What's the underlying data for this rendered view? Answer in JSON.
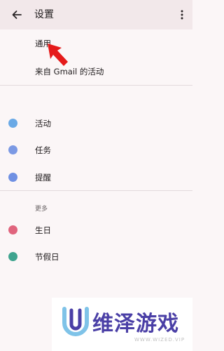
{
  "appbar": {
    "title": "设置"
  },
  "general_items": [
    {
      "label": "通用"
    },
    {
      "label": "来自 Gmail 的活动"
    }
  ],
  "calendar_items": [
    {
      "label": "活动",
      "color": "#6aa9e6"
    },
    {
      "label": "任务",
      "color": "#7b99e4"
    },
    {
      "label": "提醒",
      "color": "#6f90e3"
    }
  ],
  "more_section": {
    "header": "更多",
    "items": [
      {
        "label": "生日",
        "color": "#e0647d"
      },
      {
        "label": "节假日",
        "color": "#3fa48f"
      }
    ]
  },
  "watermark": {
    "text": "维泽游戏",
    "url": "WWW.WIZED.VIP",
    "brand_color": "#4a3fa6"
  },
  "accent_colors": {
    "arrow": "#e51a1a"
  }
}
